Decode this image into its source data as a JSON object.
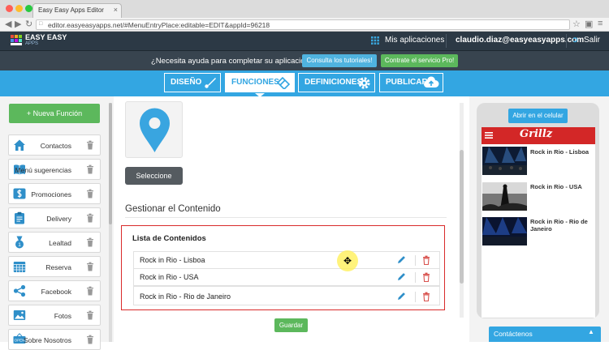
{
  "browser": {
    "tab_title": "Easy Easy Apps Editor",
    "tab_close": "×",
    "url": "editor.easyeasyapps.net/#MenuEntryPlace:editable=EDIT&appId=96218"
  },
  "appbar": {
    "logo_text": "EASY EASY",
    "logo_sub": "APPS",
    "my_apps": "Mis aplicaciones",
    "user_email": "claudio.diaz@easyeasyapps.com",
    "logout": "Salir"
  },
  "helpbar": {
    "text": "¿Necesita ayuda para completar su aplicación?",
    "tutorials_button": "Consulta los tutoriales!",
    "pro_button": "Contrate el servicio Pro!"
  },
  "nav": {
    "tabs": [
      {
        "label": "DISEÑO",
        "icon": "brush-icon"
      },
      {
        "label": "FUNCIONES",
        "icon": "tools-icon",
        "active": true
      },
      {
        "label": "DEFINICIONES",
        "icon": "gear-icon"
      },
      {
        "label": "PUBLICAR",
        "icon": "cloud-upload-icon"
      }
    ]
  },
  "sidebar": {
    "new_function_button": "+ Nueva Función",
    "items": [
      {
        "label": "Contactos",
        "icon": "house-icon"
      },
      {
        "label": "Menú sugerencias",
        "icon": "book-icon"
      },
      {
        "label": "Promociones",
        "icon": "dollar-icon"
      },
      {
        "label": "Delivery",
        "icon": "clipboard-icon"
      },
      {
        "label": "Lealtad",
        "icon": "medal-icon"
      },
      {
        "label": "Reserva",
        "icon": "calendar-icon"
      },
      {
        "label": "Facebook",
        "icon": "share-icon"
      },
      {
        "label": "Fotos",
        "icon": "photo-icon"
      },
      {
        "label": "Sobre Nosotros",
        "icon": "open-sign-icon"
      }
    ]
  },
  "main": {
    "select_button": "Seleccione",
    "manage_title": "Gestionar el Contenido",
    "list_title": "Lista de Contenidos",
    "contents": [
      "Rock in Rio - Lisboa",
      "Rock in Rio - USA",
      "Rock in Rio - Rio de Janeiro"
    ],
    "save_button": "Guardar"
  },
  "preview": {
    "open_phone_button": "Abrir en el celular",
    "app_name": "Grillz",
    "items": [
      "Rock in Rio - Lisboa",
      "Rock in Rio - USA",
      "Rock in Rio - Rio de Janeiro"
    ],
    "contact_bar": "Contáctenos"
  },
  "colors": {
    "accent_blue": "#33a6e2",
    "green": "#5cb85c",
    "dark_bar": "#2c3945",
    "app_red": "#d32727",
    "highlight_red": "#d92a2a"
  }
}
